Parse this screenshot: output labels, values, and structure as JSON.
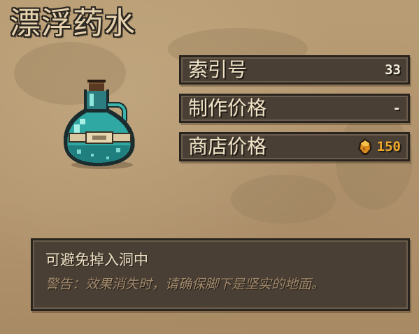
{
  "item": {
    "name": "漂浮药水",
    "icon": "teal-potion-flask-icon"
  },
  "stats": [
    {
      "label": "索引号",
      "value": "33"
    },
    {
      "label": "制作价格",
      "value": "-"
    },
    {
      "label": "商店价格",
      "value": "150",
      "icon": "gold-coin-icon",
      "value_color": "#f0a92a"
    }
  ],
  "description": {
    "main": "可避免掉入洞中",
    "warning": "警告：效果消失时，请确保脚下是坚实的地面。"
  },
  "colors": {
    "parchment": "#b69a72",
    "panel": "#4a3f34",
    "title_text": "#e6d2ae",
    "price_gold": "#f0a92a",
    "potion_teal": "#2fa7a2"
  }
}
